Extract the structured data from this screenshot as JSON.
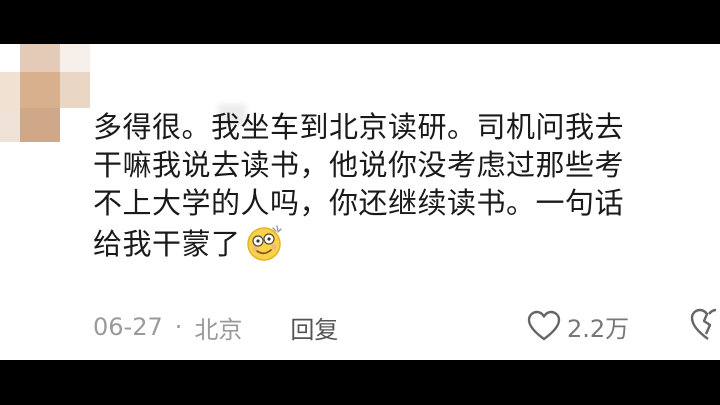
{
  "comment": {
    "lines": [
      "多得很。我坐车到北京读研。司机问我去",
      "干嘛我说去读书，他说你没考虑过那些考",
      "不上大学的人吗，你还继续读书。一句话",
      "给我干蒙了"
    ],
    "emoji": "dazed-smile-emoji"
  },
  "meta": {
    "date": "06-27",
    "separator": "·",
    "location": "北京",
    "reply_label": "回复"
  },
  "actions": {
    "like_count": "2.2万",
    "like_icon": "heart-outline-icon",
    "dislike_icon": "broken-heart-icon"
  },
  "colors": {
    "text": "#1a1a1a",
    "meta": "#9a9a9a",
    "reply": "#555555",
    "emoji_face": "#f7d24a"
  }
}
